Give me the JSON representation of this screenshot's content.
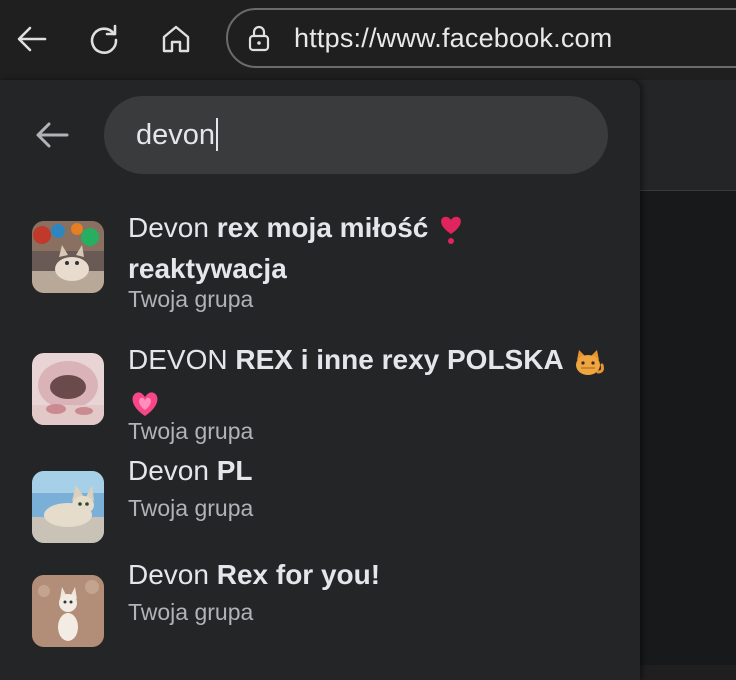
{
  "browser": {
    "url": "https://www.facebook.com"
  },
  "search": {
    "query": "devon"
  },
  "results": [
    {
      "prefix": "Devon",
      "bold": "rex moja miłość",
      "line2": "reaktywacja",
      "emoji1": "heart-exclamation",
      "subtitle": "Twoja grupa"
    },
    {
      "prefix": "DEVON",
      "bold": "REX i inne rexy POLSKA",
      "emoji1": "cat",
      "emoji2": "sparkling-heart",
      "subtitle": "Twoja grupa"
    },
    {
      "prefix": "Devon",
      "bold": "PL",
      "subtitle": "Twoja grupa"
    },
    {
      "prefix": "Devon",
      "bold": "Rex for you!",
      "subtitle": "Twoja grupa"
    }
  ],
  "colors": {
    "panel": "#242526",
    "search_box": "#3a3b3c",
    "text_primary": "#e4e6eb",
    "text_secondary": "#b0b3b8"
  }
}
